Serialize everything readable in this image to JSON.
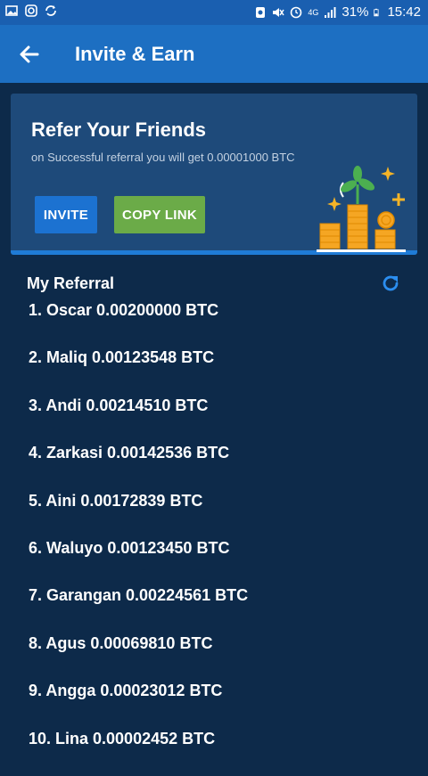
{
  "status_bar": {
    "battery": "31%",
    "time": "15:42",
    "network": "4G",
    "icons_left": [
      "image-icon",
      "instagram-icon",
      "sync-icon"
    ],
    "icons_right": [
      "alarm-icon",
      "mute-icon",
      "clock-icon",
      "signal-icon",
      "battery-icon"
    ]
  },
  "app_bar": {
    "title": "Invite & Earn",
    "back_icon": "arrow-left-icon"
  },
  "refer_card": {
    "title": "Refer Your Friends",
    "description": "on Successful referral you will get 0.00001000 BTC",
    "invite_label": "INVITE",
    "copy_link_label": "COPY LINK",
    "illustration": "money-plant-coins-icon"
  },
  "referral": {
    "heading": "My Referral",
    "refresh_icon": "refresh-icon",
    "items": [
      {
        "label": "1. Oscar 0.00200000 BTC"
      },
      {
        "label": "2. Maliq 0.00123548 BTC"
      },
      {
        "label": "3. Andi 0.00214510 BTC"
      },
      {
        "label": "4. Zarkasi 0.00142536 BTC"
      },
      {
        "label": "5. Aini 0.00172839 BTC"
      },
      {
        "label": "6. Waluyo 0.00123450 BTC"
      },
      {
        "label": "7. Garangan 0.00224561 BTC"
      },
      {
        "label": "8. Agus 0.00069810 BTC"
      },
      {
        "label": "9. Angga 0.00023012 BTC"
      },
      {
        "label": "10. Lina 0.00002452 BTC"
      }
    ]
  },
  "colors": {
    "background": "#0d2a4a",
    "app_bar": "#1d6fc2",
    "card": "#1e4a7a",
    "invite_button": "#1c72d1",
    "copy_button": "#6bab48"
  }
}
